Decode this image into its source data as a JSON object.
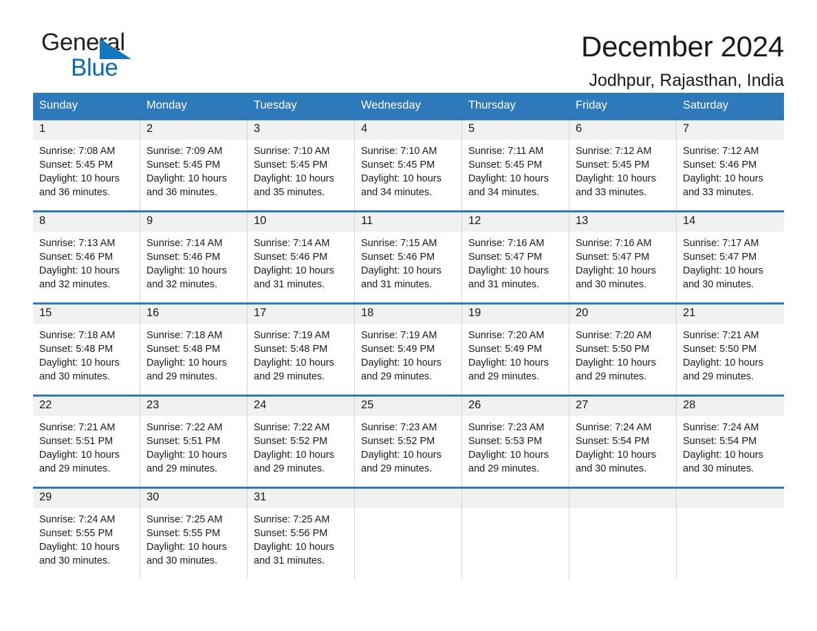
{
  "brand": {
    "name_part1": "General",
    "name_part2": "Blue",
    "triangle_color": "#1277bc",
    "blue_color": "#0a6ab5"
  },
  "header": {
    "title": "December 2024",
    "location": "Jodhpur, Rajasthan, India"
  },
  "theme": {
    "header_blue": "#2e79ba",
    "daynum_band": "#f1f1f1",
    "cell_border": "#d3d3d3"
  },
  "weekdays": [
    "Sunday",
    "Monday",
    "Tuesday",
    "Wednesday",
    "Thursday",
    "Friday",
    "Saturday"
  ],
  "weeks": [
    [
      {
        "day": "1",
        "sunrise": "Sunrise: 7:08 AM",
        "sunset": "Sunset: 5:45 PM",
        "daylight_line1": "Daylight: 10 hours",
        "daylight_line2": "and 36 minutes."
      },
      {
        "day": "2",
        "sunrise": "Sunrise: 7:09 AM",
        "sunset": "Sunset: 5:45 PM",
        "daylight_line1": "Daylight: 10 hours",
        "daylight_line2": "and 36 minutes."
      },
      {
        "day": "3",
        "sunrise": "Sunrise: 7:10 AM",
        "sunset": "Sunset: 5:45 PM",
        "daylight_line1": "Daylight: 10 hours",
        "daylight_line2": "and 35 minutes."
      },
      {
        "day": "4",
        "sunrise": "Sunrise: 7:10 AM",
        "sunset": "Sunset: 5:45 PM",
        "daylight_line1": "Daylight: 10 hours",
        "daylight_line2": "and 34 minutes."
      },
      {
        "day": "5",
        "sunrise": "Sunrise: 7:11 AM",
        "sunset": "Sunset: 5:45 PM",
        "daylight_line1": "Daylight: 10 hours",
        "daylight_line2": "and 34 minutes."
      },
      {
        "day": "6",
        "sunrise": "Sunrise: 7:12 AM",
        "sunset": "Sunset: 5:45 PM",
        "daylight_line1": "Daylight: 10 hours",
        "daylight_line2": "and 33 minutes."
      },
      {
        "day": "7",
        "sunrise": "Sunrise: 7:12 AM",
        "sunset": "Sunset: 5:46 PM",
        "daylight_line1": "Daylight: 10 hours",
        "daylight_line2": "and 33 minutes."
      }
    ],
    [
      {
        "day": "8",
        "sunrise": "Sunrise: 7:13 AM",
        "sunset": "Sunset: 5:46 PM",
        "daylight_line1": "Daylight: 10 hours",
        "daylight_line2": "and 32 minutes."
      },
      {
        "day": "9",
        "sunrise": "Sunrise: 7:14 AM",
        "sunset": "Sunset: 5:46 PM",
        "daylight_line1": "Daylight: 10 hours",
        "daylight_line2": "and 32 minutes."
      },
      {
        "day": "10",
        "sunrise": "Sunrise: 7:14 AM",
        "sunset": "Sunset: 5:46 PM",
        "daylight_line1": "Daylight: 10 hours",
        "daylight_line2": "and 31 minutes."
      },
      {
        "day": "11",
        "sunrise": "Sunrise: 7:15 AM",
        "sunset": "Sunset: 5:46 PM",
        "daylight_line1": "Daylight: 10 hours",
        "daylight_line2": "and 31 minutes."
      },
      {
        "day": "12",
        "sunrise": "Sunrise: 7:16 AM",
        "sunset": "Sunset: 5:47 PM",
        "daylight_line1": "Daylight: 10 hours",
        "daylight_line2": "and 31 minutes."
      },
      {
        "day": "13",
        "sunrise": "Sunrise: 7:16 AM",
        "sunset": "Sunset: 5:47 PM",
        "daylight_line1": "Daylight: 10 hours",
        "daylight_line2": "and 30 minutes."
      },
      {
        "day": "14",
        "sunrise": "Sunrise: 7:17 AM",
        "sunset": "Sunset: 5:47 PM",
        "daylight_line1": "Daylight: 10 hours",
        "daylight_line2": "and 30 minutes."
      }
    ],
    [
      {
        "day": "15",
        "sunrise": "Sunrise: 7:18 AM",
        "sunset": "Sunset: 5:48 PM",
        "daylight_line1": "Daylight: 10 hours",
        "daylight_line2": "and 30 minutes."
      },
      {
        "day": "16",
        "sunrise": "Sunrise: 7:18 AM",
        "sunset": "Sunset: 5:48 PM",
        "daylight_line1": "Daylight: 10 hours",
        "daylight_line2": "and 29 minutes."
      },
      {
        "day": "17",
        "sunrise": "Sunrise: 7:19 AM",
        "sunset": "Sunset: 5:48 PM",
        "daylight_line1": "Daylight: 10 hours",
        "daylight_line2": "and 29 minutes."
      },
      {
        "day": "18",
        "sunrise": "Sunrise: 7:19 AM",
        "sunset": "Sunset: 5:49 PM",
        "daylight_line1": "Daylight: 10 hours",
        "daylight_line2": "and 29 minutes."
      },
      {
        "day": "19",
        "sunrise": "Sunrise: 7:20 AM",
        "sunset": "Sunset: 5:49 PM",
        "daylight_line1": "Daylight: 10 hours",
        "daylight_line2": "and 29 minutes."
      },
      {
        "day": "20",
        "sunrise": "Sunrise: 7:20 AM",
        "sunset": "Sunset: 5:50 PM",
        "daylight_line1": "Daylight: 10 hours",
        "daylight_line2": "and 29 minutes."
      },
      {
        "day": "21",
        "sunrise": "Sunrise: 7:21 AM",
        "sunset": "Sunset: 5:50 PM",
        "daylight_line1": "Daylight: 10 hours",
        "daylight_line2": "and 29 minutes."
      }
    ],
    [
      {
        "day": "22",
        "sunrise": "Sunrise: 7:21 AM",
        "sunset": "Sunset: 5:51 PM",
        "daylight_line1": "Daylight: 10 hours",
        "daylight_line2": "and 29 minutes."
      },
      {
        "day": "23",
        "sunrise": "Sunrise: 7:22 AM",
        "sunset": "Sunset: 5:51 PM",
        "daylight_line1": "Daylight: 10 hours",
        "daylight_line2": "and 29 minutes."
      },
      {
        "day": "24",
        "sunrise": "Sunrise: 7:22 AM",
        "sunset": "Sunset: 5:52 PM",
        "daylight_line1": "Daylight: 10 hours",
        "daylight_line2": "and 29 minutes."
      },
      {
        "day": "25",
        "sunrise": "Sunrise: 7:23 AM",
        "sunset": "Sunset: 5:52 PM",
        "daylight_line1": "Daylight: 10 hours",
        "daylight_line2": "and 29 minutes."
      },
      {
        "day": "26",
        "sunrise": "Sunrise: 7:23 AM",
        "sunset": "Sunset: 5:53 PM",
        "daylight_line1": "Daylight: 10 hours",
        "daylight_line2": "and 29 minutes."
      },
      {
        "day": "27",
        "sunrise": "Sunrise: 7:24 AM",
        "sunset": "Sunset: 5:54 PM",
        "daylight_line1": "Daylight: 10 hours",
        "daylight_line2": "and 30 minutes."
      },
      {
        "day": "28",
        "sunrise": "Sunrise: 7:24 AM",
        "sunset": "Sunset: 5:54 PM",
        "daylight_line1": "Daylight: 10 hours",
        "daylight_line2": "and 30 minutes."
      }
    ],
    [
      {
        "day": "29",
        "sunrise": "Sunrise: 7:24 AM",
        "sunset": "Sunset: 5:55 PM",
        "daylight_line1": "Daylight: 10 hours",
        "daylight_line2": "and 30 minutes."
      },
      {
        "day": "30",
        "sunrise": "Sunrise: 7:25 AM",
        "sunset": "Sunset: 5:55 PM",
        "daylight_line1": "Daylight: 10 hours",
        "daylight_line2": "and 30 minutes."
      },
      {
        "day": "31",
        "sunrise": "Sunrise: 7:25 AM",
        "sunset": "Sunset: 5:56 PM",
        "daylight_line1": "Daylight: 10 hours",
        "daylight_line2": "and 31 minutes."
      },
      {
        "day": "",
        "sunrise": "",
        "sunset": "",
        "daylight_line1": "",
        "daylight_line2": ""
      },
      {
        "day": "",
        "sunrise": "",
        "sunset": "",
        "daylight_line1": "",
        "daylight_line2": ""
      },
      {
        "day": "",
        "sunrise": "",
        "sunset": "",
        "daylight_line1": "",
        "daylight_line2": ""
      },
      {
        "day": "",
        "sunrise": "",
        "sunset": "",
        "daylight_line1": "",
        "daylight_line2": ""
      }
    ]
  ]
}
